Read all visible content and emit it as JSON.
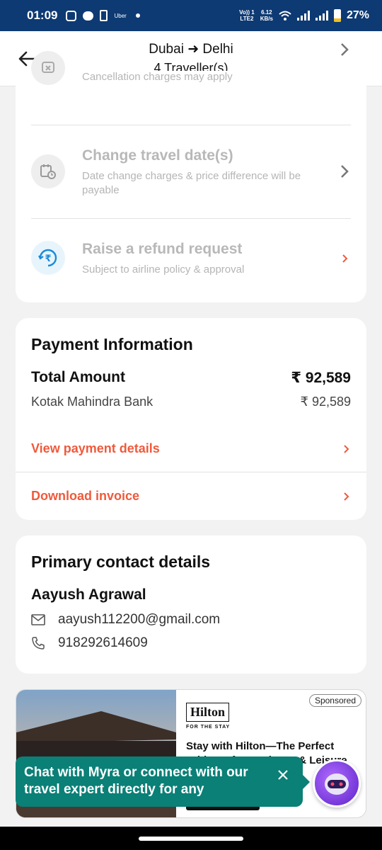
{
  "status_bar": {
    "time": "01:09",
    "carrier_icon_text": "Uber",
    "net_top": "Vo)) 1",
    "net_bottom": "LTE2",
    "speed_top": "6.12",
    "speed_bottom": "KB/s",
    "battery_percent": "27%",
    "battery_level": 0.27
  },
  "header": {
    "origin": "Dubai",
    "arrow": "➜",
    "destination": "Delhi",
    "travellers": "4 Traveller(s)"
  },
  "options": [
    {
      "title": "",
      "subtitle": "Cancellation charges may apply",
      "icon": "cancel-ticket-icon"
    },
    {
      "title": "Change travel date(s)",
      "subtitle": "Date change charges & price difference will be payable",
      "icon": "calendar-clock-icon"
    },
    {
      "title": "Raise a refund request",
      "subtitle": "Subject to airline policy & approval",
      "icon": "rupee-refund-icon"
    }
  ],
  "payment": {
    "heading": "Payment Information",
    "total_label": "Total Amount",
    "total_value": "₹ 92,589",
    "bank_label": "Kotak Mahindra Bank",
    "bank_value": "₹ 92,589",
    "view_details": "View payment details",
    "download_invoice": "Download invoice"
  },
  "contact": {
    "heading": "Primary contact details",
    "name": "Aayush Agrawal",
    "email": "aayush112200@gmail.com",
    "phone": "918292614609"
  },
  "ad": {
    "sponsored": "Sponsored",
    "brand": "Hilton",
    "tagline": "FOR THE STAY",
    "headline": "Stay with Hilton—The Perfect Address for Business & Leisure"
  },
  "chat": {
    "message": "Chat with Myra or connect with our travel expert directly for any"
  },
  "colors": {
    "status_bar": "#0d3a73",
    "accent_orange": "#ef5a3c",
    "chat_teal": "#0a8077",
    "refund_icon_blue": "#1a8ad8"
  }
}
